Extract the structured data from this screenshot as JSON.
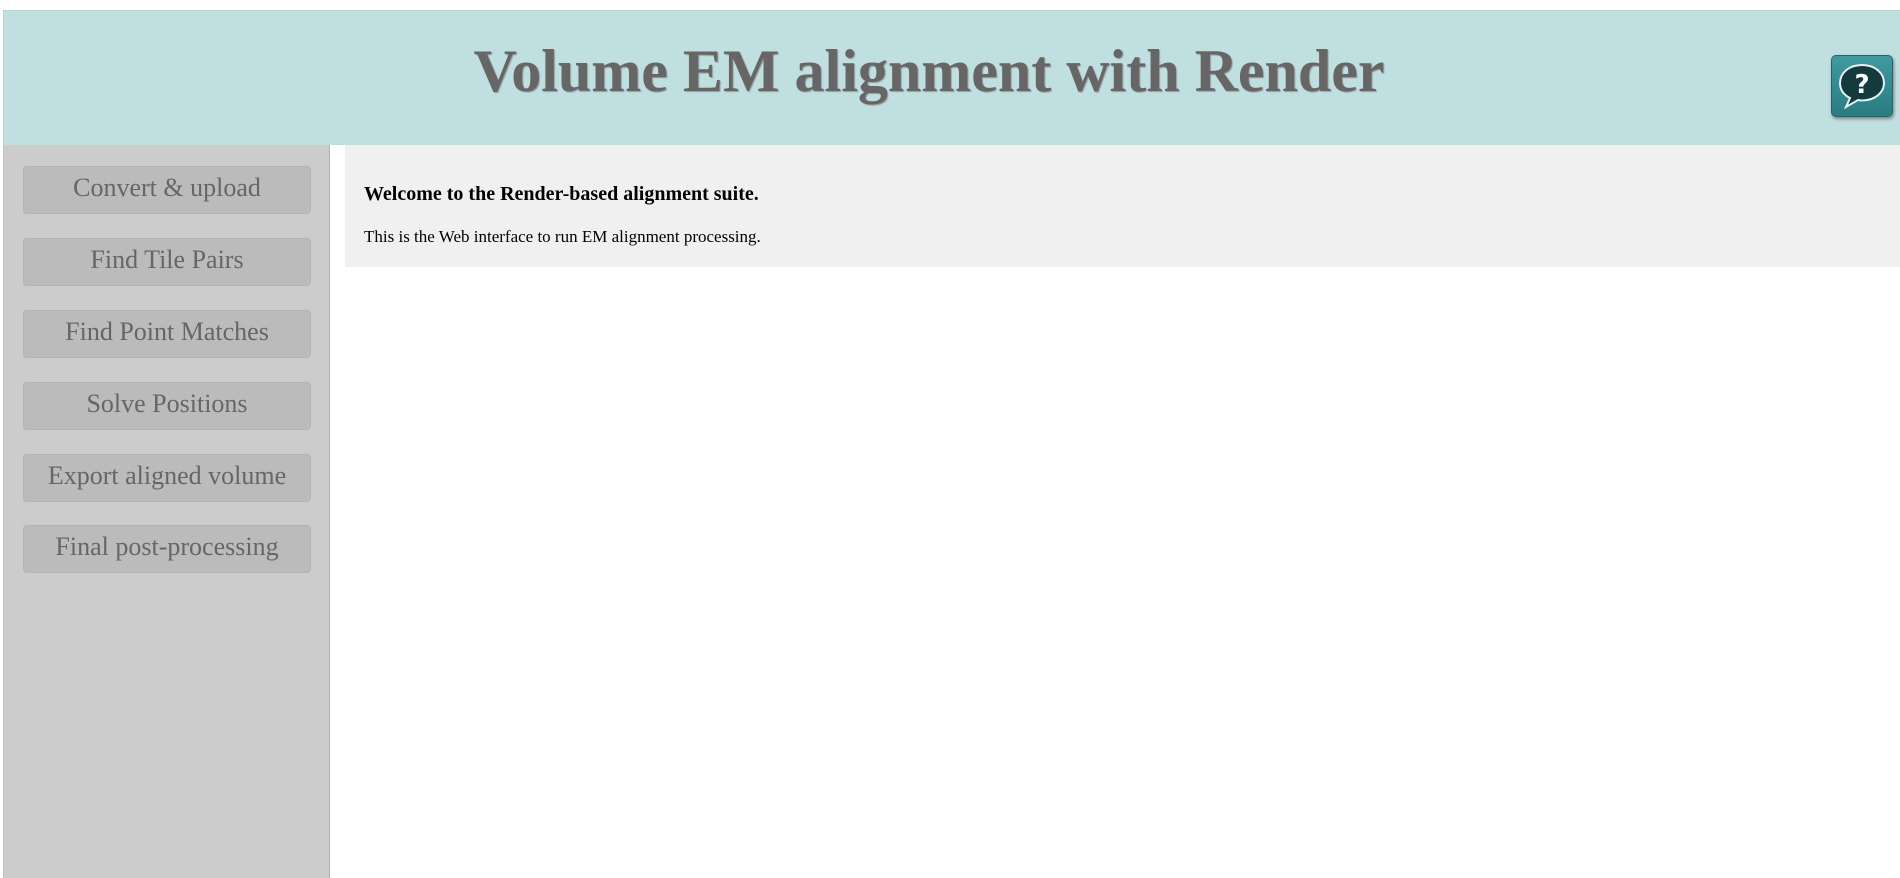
{
  "header": {
    "title": "Volume EM alignment with Render",
    "help_icon": "help-question-bubble-icon"
  },
  "sidebar": {
    "items": [
      {
        "label": "Convert & upload"
      },
      {
        "label": "Find Tile Pairs"
      },
      {
        "label": "Find Point Matches"
      },
      {
        "label": "Solve Positions"
      },
      {
        "label": "Export aligned volume"
      },
      {
        "label": "Final post-processing"
      }
    ]
  },
  "main": {
    "welcome_title": "Welcome to the Render-based alignment suite.",
    "welcome_text": "This is the Web interface to run EM alignment processing."
  },
  "colors": {
    "header_bg": "#c0dfe1",
    "sidebar_bg": "#cccccc",
    "nav_button_bg": "#bbbbbb",
    "content_bg": "#f0f0f0",
    "text_gray": "#666666",
    "help_button": "#2f8a90"
  }
}
